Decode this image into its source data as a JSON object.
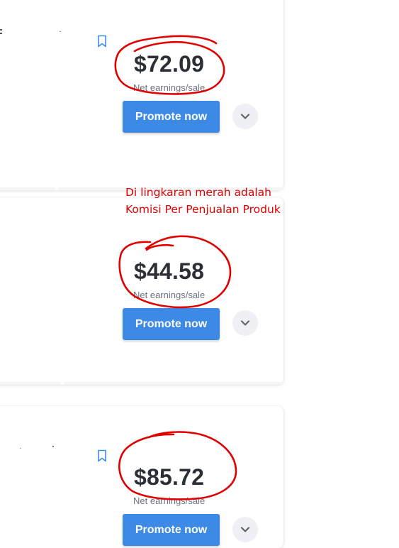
{
  "products": [
    {
      "price": "$72.09",
      "earnings_label": "Net earnings/sale",
      "promote_label": "Promote now"
    },
    {
      "price": "$44.58",
      "earnings_label": "Net earnings/sale",
      "promote_label": "Promote now"
    },
    {
      "price": "$85.72",
      "earnings_label": "Net earnings/sale",
      "promote_label": "Promote now"
    }
  ],
  "annotation": {
    "line1": "Di lingkaran merah adalah",
    "line2": "Komisi Per Penjualan Produk",
    "color": "#e00000"
  },
  "icons": {
    "bookmark": "bookmark-icon",
    "expand": "chevron-down-icon"
  },
  "colors": {
    "accent": "#3c8ae6",
    "price_text": "#2b2f36",
    "annotation_red": "#e00000"
  }
}
